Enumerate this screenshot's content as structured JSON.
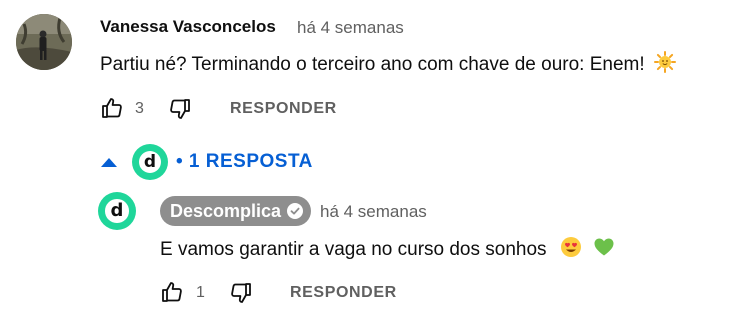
{
  "comment": {
    "author": "Vanessa Vasconcelos",
    "time": "há 4 semanas",
    "text": "Partiu né? Terminando o terceiro ano com chave de ouro: Enem!",
    "emoji": "sun-with-face",
    "like_count": "3",
    "reply_label": "RESPONDER"
  },
  "replies_toggle": {
    "label": "• 1 RESPOSTA",
    "avatar_letter": "d"
  },
  "reply": {
    "avatar_letter": "d",
    "author": "Descomplica",
    "verified": true,
    "time": "há 4 semanas",
    "text": "E vamos garantir a vaga no curso dos sonhos",
    "emojis": [
      "smiling-face-with-heart-eyes",
      "green-heart"
    ],
    "like_count": "1",
    "reply_label": "RESPONDER"
  },
  "colors": {
    "brand_green": "#1fd69a",
    "link_blue": "#065fd4",
    "secondary_text": "#606060",
    "owner_badge_bg": "#8e8e8e"
  }
}
